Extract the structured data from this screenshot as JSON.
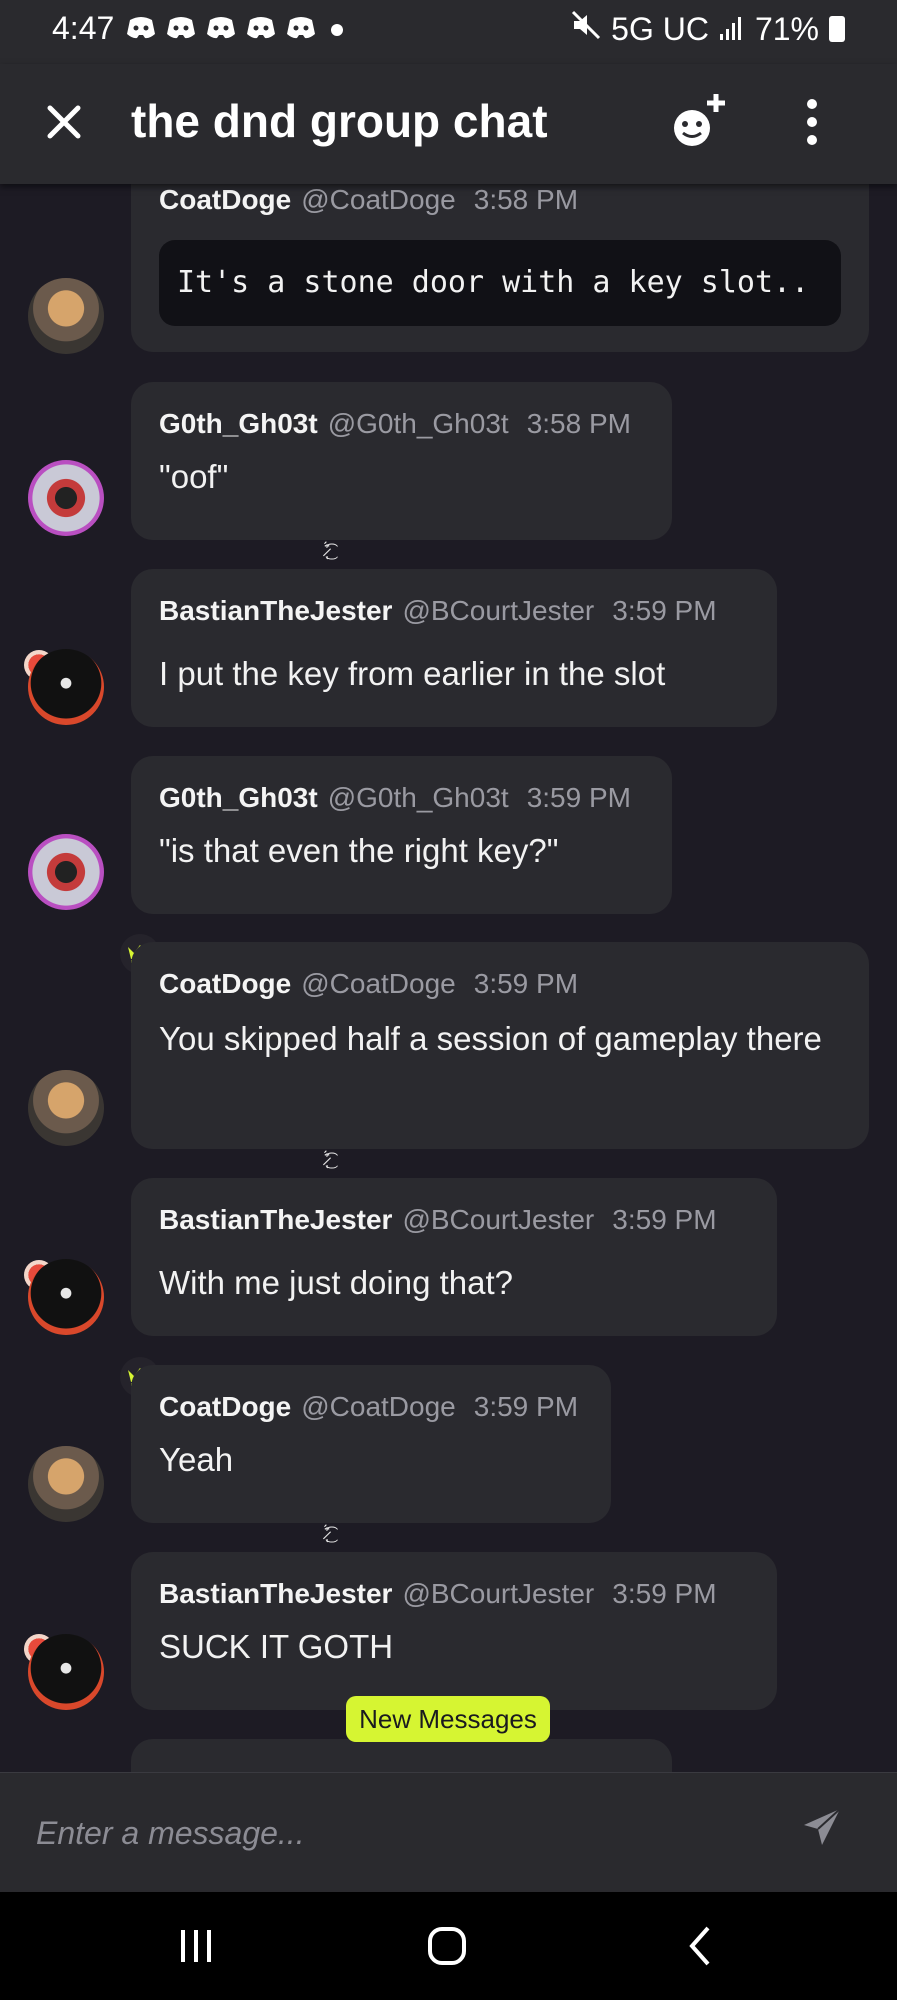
{
  "status_bar": {
    "time": "4:47",
    "network": "5G UC",
    "battery": "71%"
  },
  "header": {
    "title": "the dnd group chat"
  },
  "messages": [
    {
      "author": "CoatDoge",
      "handle": "@CoatDoge",
      "time": "3:58 PM",
      "text": "It's a stone door with a key slot.."
    },
    {
      "author": "G0th_Gh03t",
      "handle": "@G0th_Gh03t",
      "time": "3:58 PM",
      "text": "\"oof\""
    },
    {
      "author": "BastianTheJester",
      "handle": "@BCourtJester",
      "time": "3:59 PM",
      "text": "I put the key from earlier in the slot"
    },
    {
      "author": "G0th_Gh03t",
      "handle": "@G0th_Gh03t",
      "time": "3:59 PM",
      "text": "\"is that even the right key?\""
    },
    {
      "author": "CoatDoge",
      "handle": "@CoatDoge",
      "time": "3:59 PM",
      "text": "You skipped half a session of gameplay there"
    },
    {
      "author": "BastianTheJester",
      "handle": "@BCourtJester",
      "time": "3:59 PM",
      "text": "With me just doing that?"
    },
    {
      "author": "CoatDoge",
      "handle": "@CoatDoge",
      "time": "3:59 PM",
      "text": "Yeah"
    },
    {
      "author": "BastianTheJester",
      "handle": "@BCourtJester",
      "time": "3:59 PM",
      "text": "SUCK IT GOTH"
    }
  ],
  "new_messages_label": "New Messages",
  "composer": {
    "placeholder": "Enter a message..."
  },
  "icons": {
    "close": "close-icon",
    "add_member": "add-member-icon",
    "more": "more-vertical-icon",
    "send": "send-icon",
    "owner_crown": "crown-icon",
    "nav_recents": "recents-icon",
    "nav_home": "home-icon",
    "nav_back": "back-icon"
  },
  "colors": {
    "accent": "#d6f532",
    "background": "#1d1b24",
    "bubble": "#2a2a2f",
    "header": "#2a2a2e"
  }
}
